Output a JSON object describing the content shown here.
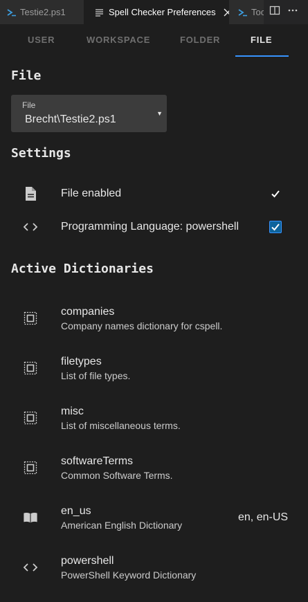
{
  "editor_tabs": [
    {
      "label": "Testie2.ps1",
      "icon": "powershell-icon"
    },
    {
      "label": "Spell Checker Preferences",
      "icon": "preview-icon"
    },
    {
      "label": "Too",
      "icon": "powershell-icon"
    }
  ],
  "scope_tabs": [
    "USER",
    "WORKSPACE",
    "FOLDER",
    "FILE"
  ],
  "active_scope": "FILE",
  "file_section": {
    "heading": "File",
    "select_label": "File",
    "select_value": "Brecht\\Testie2.ps1"
  },
  "settings_section": {
    "heading": "Settings",
    "items": [
      {
        "label": "File enabled",
        "icon": "file-icon",
        "checked": true
      },
      {
        "label": "Programming Language: powershell",
        "icon": "code-icon",
        "checked": true
      }
    ]
  },
  "dictionaries_section": {
    "heading": "Active Dictionaries",
    "items": [
      {
        "name": "companies",
        "description": "Company names dictionary for cspell.",
        "icon": "dictionary-icon",
        "locale": ""
      },
      {
        "name": "filetypes",
        "description": "List of file types.",
        "icon": "dictionary-icon",
        "locale": ""
      },
      {
        "name": "misc",
        "description": "List of miscellaneous terms.",
        "icon": "dictionary-icon",
        "locale": ""
      },
      {
        "name": "softwareTerms",
        "description": "Common Software Terms.",
        "icon": "dictionary-icon",
        "locale": ""
      },
      {
        "name": "en_us",
        "description": "American English Dictionary",
        "icon": "book-icon",
        "locale": "en, en-US"
      },
      {
        "name": "powershell",
        "description": "PowerShell Keyword Dictionary",
        "icon": "code-icon",
        "locale": ""
      }
    ]
  },
  "colors": {
    "accent": "#3794ff",
    "background": "#1e1e1e",
    "checkbox_blue": "#0e639c"
  }
}
